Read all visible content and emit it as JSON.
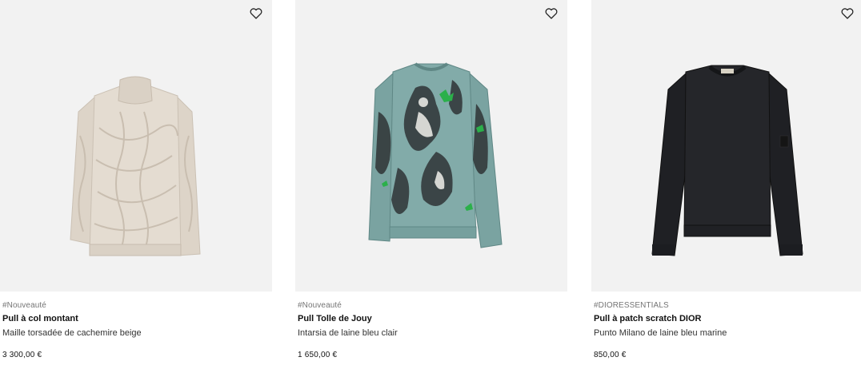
{
  "products": [
    {
      "tag": "#Nouveauté",
      "name": "Pull à col montant",
      "description": "Maille torsadée de cachemire beige",
      "price": "3 300,00 €",
      "image_icon": "beige-cable-knit-turtleneck",
      "color": "#e3dbd0"
    },
    {
      "tag": "#Nouveauté",
      "name": "Pull Tolle de Jouy",
      "description": "Intarsia de laine bleu clair",
      "price": "1 650,00 €",
      "image_icon": "light-blue-toile-de-jouy-sweater",
      "color": "#7fa7a5"
    },
    {
      "tag": "#DIORESSENTIALS",
      "name": "Pull à patch scratch DIOR",
      "description": "Punto Milano de laine bleu marine",
      "price": "850,00 €",
      "image_icon": "navy-crewneck-sweater",
      "color": "#232428"
    }
  ],
  "wishlist_icon": "heart-outline-icon"
}
